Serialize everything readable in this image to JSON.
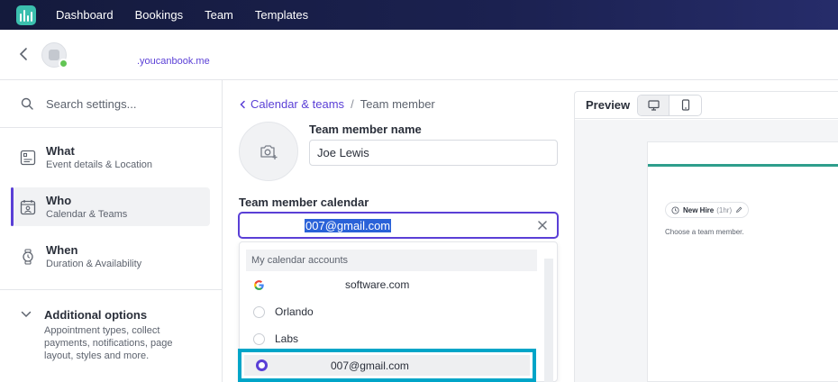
{
  "topnav": {
    "items": [
      "Dashboard",
      "Bookings",
      "Team",
      "Templates"
    ]
  },
  "subheader": {
    "domain": ".youcanbook.me"
  },
  "sidebar": {
    "search_placeholder": "Search settings...",
    "items": [
      {
        "title": "What",
        "subtitle": "Event details & Location",
        "icon": "details-icon",
        "active": false
      },
      {
        "title": "Who",
        "subtitle": "Calendar & Teams",
        "icon": "team-calendar-icon",
        "active": true
      },
      {
        "title": "When",
        "subtitle": "Duration & Availability",
        "icon": "watch-icon",
        "active": false
      }
    ],
    "additional": {
      "title": "Additional options",
      "description": "Appointment types, collect payments, notifications, page layout, styles and more."
    }
  },
  "breadcrumb": {
    "link": "Calendar & teams",
    "separator": "/",
    "current": "Team member"
  },
  "form": {
    "name_label": "Team member name",
    "name_value": "Joe Lewis",
    "calendar_label": "Team member calendar",
    "calendar_value": "007@gmail.com"
  },
  "dropdown": {
    "header": "My calendar accounts",
    "options": [
      {
        "label": "software.com",
        "icon": "google-icon"
      },
      {
        "label": "Orlando",
        "icon": "radio-icon"
      },
      {
        "label": "Labs",
        "icon": "radio-icon"
      }
    ],
    "selected": "007@gmail.com"
  },
  "preview": {
    "title": "Preview",
    "chip_label": "New Hire",
    "chip_duration": "(1hr)",
    "choose_text": "Choose a team member."
  },
  "colors": {
    "accent": "#5a3fd6",
    "teal": "#2e9e8c",
    "highlight_border": "#00a5c8",
    "nav_bg": "#141a3c"
  }
}
